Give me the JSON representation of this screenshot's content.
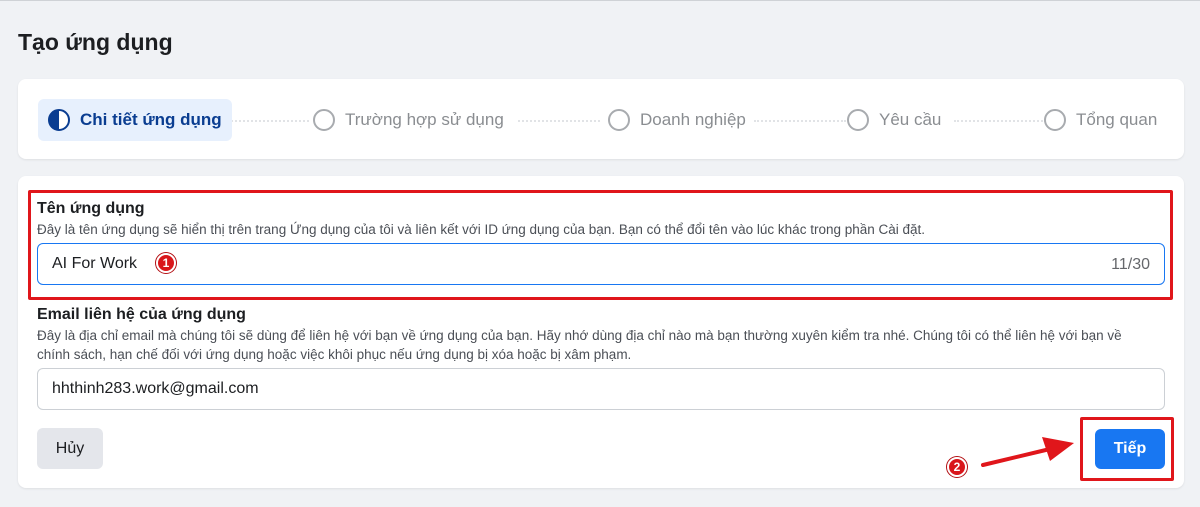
{
  "page": {
    "title": "Tạo ứng dụng"
  },
  "stepper": {
    "steps": [
      {
        "label": "Chi tiết ứng dụng",
        "state": "active"
      },
      {
        "label": "Trường hợp sử dụng",
        "state": "pending"
      },
      {
        "label": "Doanh nghiệp",
        "state": "pending"
      },
      {
        "label": "Yêu cầu",
        "state": "pending"
      },
      {
        "label": "Tổng quan",
        "state": "pending"
      }
    ]
  },
  "form": {
    "app_name": {
      "label": "Tên ứng dụng",
      "description": "Đây là tên ứng dụng sẽ hiển thị trên trang Ứng dụng của tôi và liên kết với ID ứng dụng của bạn. Bạn có thể đổi tên vào lúc khác trong phần Cài đặt.",
      "value": "AI For Work",
      "counter": "11/30"
    },
    "email": {
      "label": "Email liên hệ của ứng dụng",
      "description": "Đây là địa chỉ email mà chúng tôi sẽ dùng để liên hệ với bạn về ứng dụng của bạn. Hãy nhớ dùng địa chỉ nào mà bạn thường xuyên kiểm tra nhé. Chúng tôi có thể liên hệ với bạn về chính sách, hạn chế đối với ứng dụng hoặc việc khôi phục nếu ứng dụng bị xóa hoặc bị xâm phạm.",
      "value": "hhthinh283.work@gmail.com"
    },
    "cancel_label": "Hủy",
    "next_label": "Tiếp"
  },
  "annotations": {
    "badge_1": "1",
    "badge_2": "2",
    "highlight_color": "#e0161b"
  },
  "colors": {
    "primary": "#1877f2",
    "active_step_bg": "#e7f0fd",
    "active_step_text": "#0a3d91"
  }
}
